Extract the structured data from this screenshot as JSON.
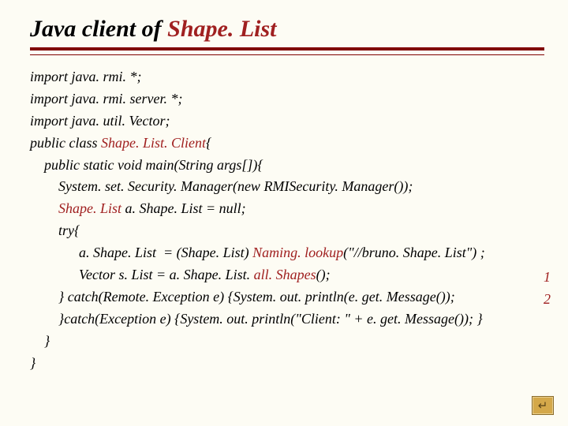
{
  "title_plain": "Java client of ",
  "title_hl": "Shape. List",
  "code": {
    "l1": "import java. rmi. *;",
    "l2": "import java. rmi. server. *;",
    "l3": "import java. util. Vector;",
    "l4a": "public class ",
    "l4b": "Shape. List. Client",
    "l4c": "{",
    "l5": "public static void main(String args[]){",
    "l6": "System. set. Security. Manager(new RMISecurity. Manager());",
    "l7a": "Shape. List",
    "l7b": " a. Shape. List = null;",
    "l8": "try{",
    "l9a": "a. Shape. List  = (Shape. List) ",
    "l9b": "Naming. lookup",
    "l9c": "(\"//bruno. Shape. List\") ;",
    "l10a": "Vector s. List = a. Shape. List. ",
    "l10b": "all. Shapes",
    "l10c": "();",
    "l11": "} catch(Remote. Exception e) {System. out. println(e. get. Message());",
    "l12": "}catch(Exception e) {System. out. println(\"Client: \" + e. get. Message()); }",
    "l13": "}",
    "l14": "}"
  },
  "annotations": {
    "a1": "1",
    "a2": "2"
  },
  "footer_icon": "↵"
}
